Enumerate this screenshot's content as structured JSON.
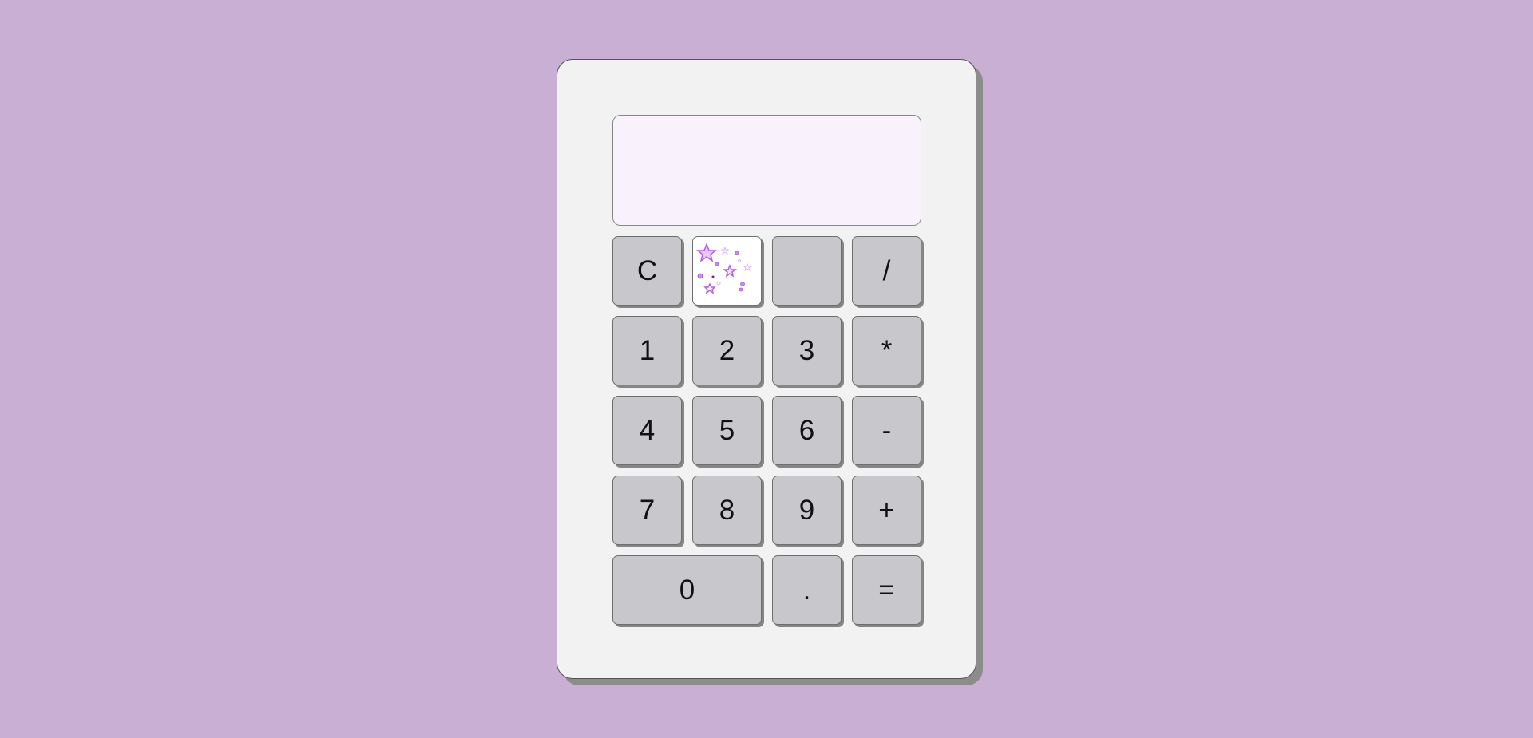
{
  "display": {
    "value": ""
  },
  "keys": {
    "clear": "C",
    "blank": "",
    "divide": "/",
    "one": "1",
    "two": "2",
    "three": "3",
    "multiply": "*",
    "four": "4",
    "five": "5",
    "six": "6",
    "subtract": "-",
    "seven": "7",
    "eight": "8",
    "nine": "9",
    "add": "+",
    "zero": "0",
    "decimal": ".",
    "equals": "="
  },
  "colors": {
    "background": "#c9afd4",
    "body": "#f2f2f2",
    "display": "#f9f2fd",
    "key": "#c8c7cb",
    "star_accent": "#b45ee6"
  },
  "icons": {
    "sparkle_key": "stars-icon"
  }
}
